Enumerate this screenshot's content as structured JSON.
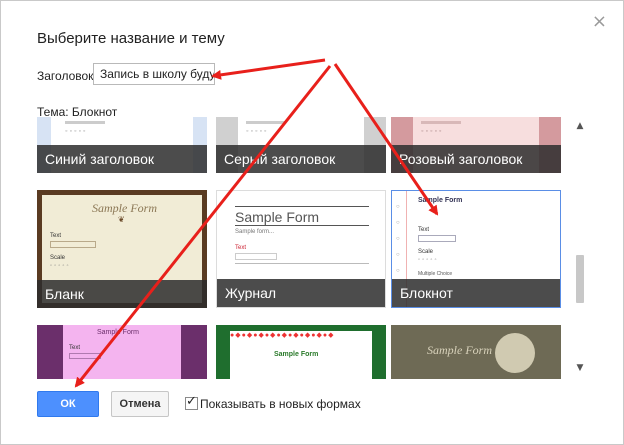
{
  "dialog": {
    "title": "Выберите название и тему",
    "close_glyph": "×",
    "header_label": "Заголовок",
    "header_value": "Запись в школу будущ",
    "theme_label": "Тема: Блокнот",
    "themes": [
      {
        "label": "Синий заголовок"
      },
      {
        "label": "Серый заголовок"
      },
      {
        "label": "Розовый заголовок"
      },
      {
        "label": "Бланк"
      },
      {
        "label": "Журнал"
      },
      {
        "label": "Блокнот",
        "selected": true
      },
      {
        "label": ""
      },
      {
        "label": ""
      },
      {
        "label": ""
      }
    ],
    "preview": {
      "sample_form": "Sample Form",
      "multiple_choice": "Multiple Choice",
      "text": "Text",
      "scale": "Scale",
      "help_text": "Help text",
      "sample_form_sub": "Sample form..."
    },
    "ok_label": "ОК",
    "cancel_label": "Отмена",
    "checkbox_label": "Показывать в новых формах",
    "checkbox_checked": true,
    "check_glyph": "✓",
    "scroll_up": "▲",
    "scroll_down": "▼",
    "annotation_color": "#e8201b",
    "accent": "#4d90fe"
  }
}
